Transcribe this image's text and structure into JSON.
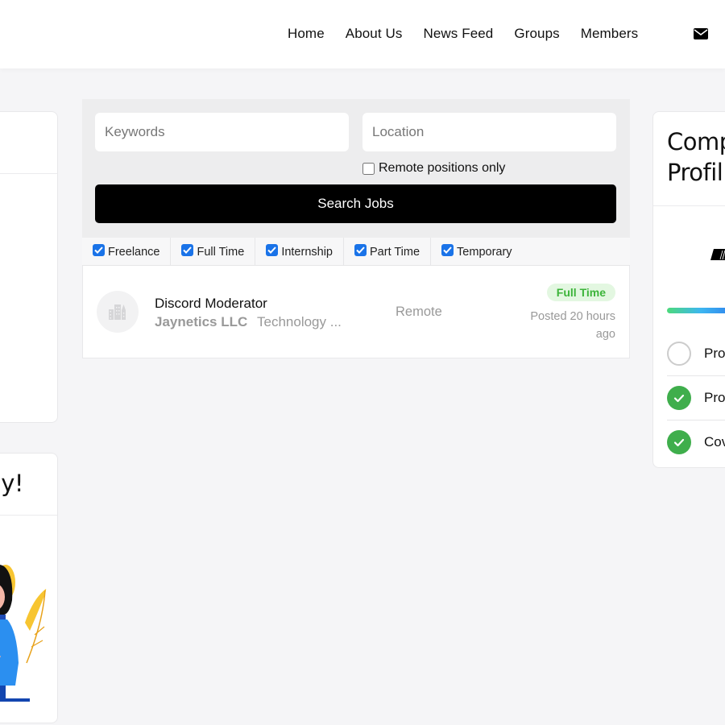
{
  "nav": {
    "items": [
      {
        "label": "Home"
      },
      {
        "label": "About Us"
      },
      {
        "label": "News Feed"
      },
      {
        "label": "Groups"
      },
      {
        "label": "Members"
      }
    ],
    "mail_icon": "envelope-icon"
  },
  "left_cards": {
    "second_title_fragment": "ay!"
  },
  "search": {
    "keywords_placeholder": "Keywords",
    "keywords_value": "",
    "location_placeholder": "Location",
    "location_value": "",
    "remote_only_label": "Remote positions only",
    "remote_only_checked": false,
    "submit_label": "Search Jobs"
  },
  "job_types": [
    {
      "label": "Freelance",
      "checked": true
    },
    {
      "label": "Full Time",
      "checked": true
    },
    {
      "label": "Internship",
      "checked": true
    },
    {
      "label": "Part Time",
      "checked": true
    },
    {
      "label": "Temporary",
      "checked": true
    }
  ],
  "jobs": [
    {
      "title": "Discord Moderator",
      "company": "Jaynetics LLC",
      "category": "Technology ...",
      "location": "Remote",
      "type_badge": "Full Time",
      "posted": "Posted 20 hours ago",
      "logo_icon": "building-icon"
    }
  ],
  "profile_card": {
    "title_line1": "Comp",
    "title_line2": "Profil",
    "progress_fraction": 0.67,
    "checklist": [
      {
        "label": "Pro",
        "done": false
      },
      {
        "label": "Pro",
        "done": true
      },
      {
        "label": "Cov",
        "done": true
      }
    ]
  },
  "colors": {
    "accent_blue": "#1a73e8",
    "badge_green": "#3cb43a",
    "badge_green_bg": "#e3f7e1",
    "check_green": "#3fae4c",
    "button_black": "#000000",
    "page_bg": "#f5f5f7"
  }
}
